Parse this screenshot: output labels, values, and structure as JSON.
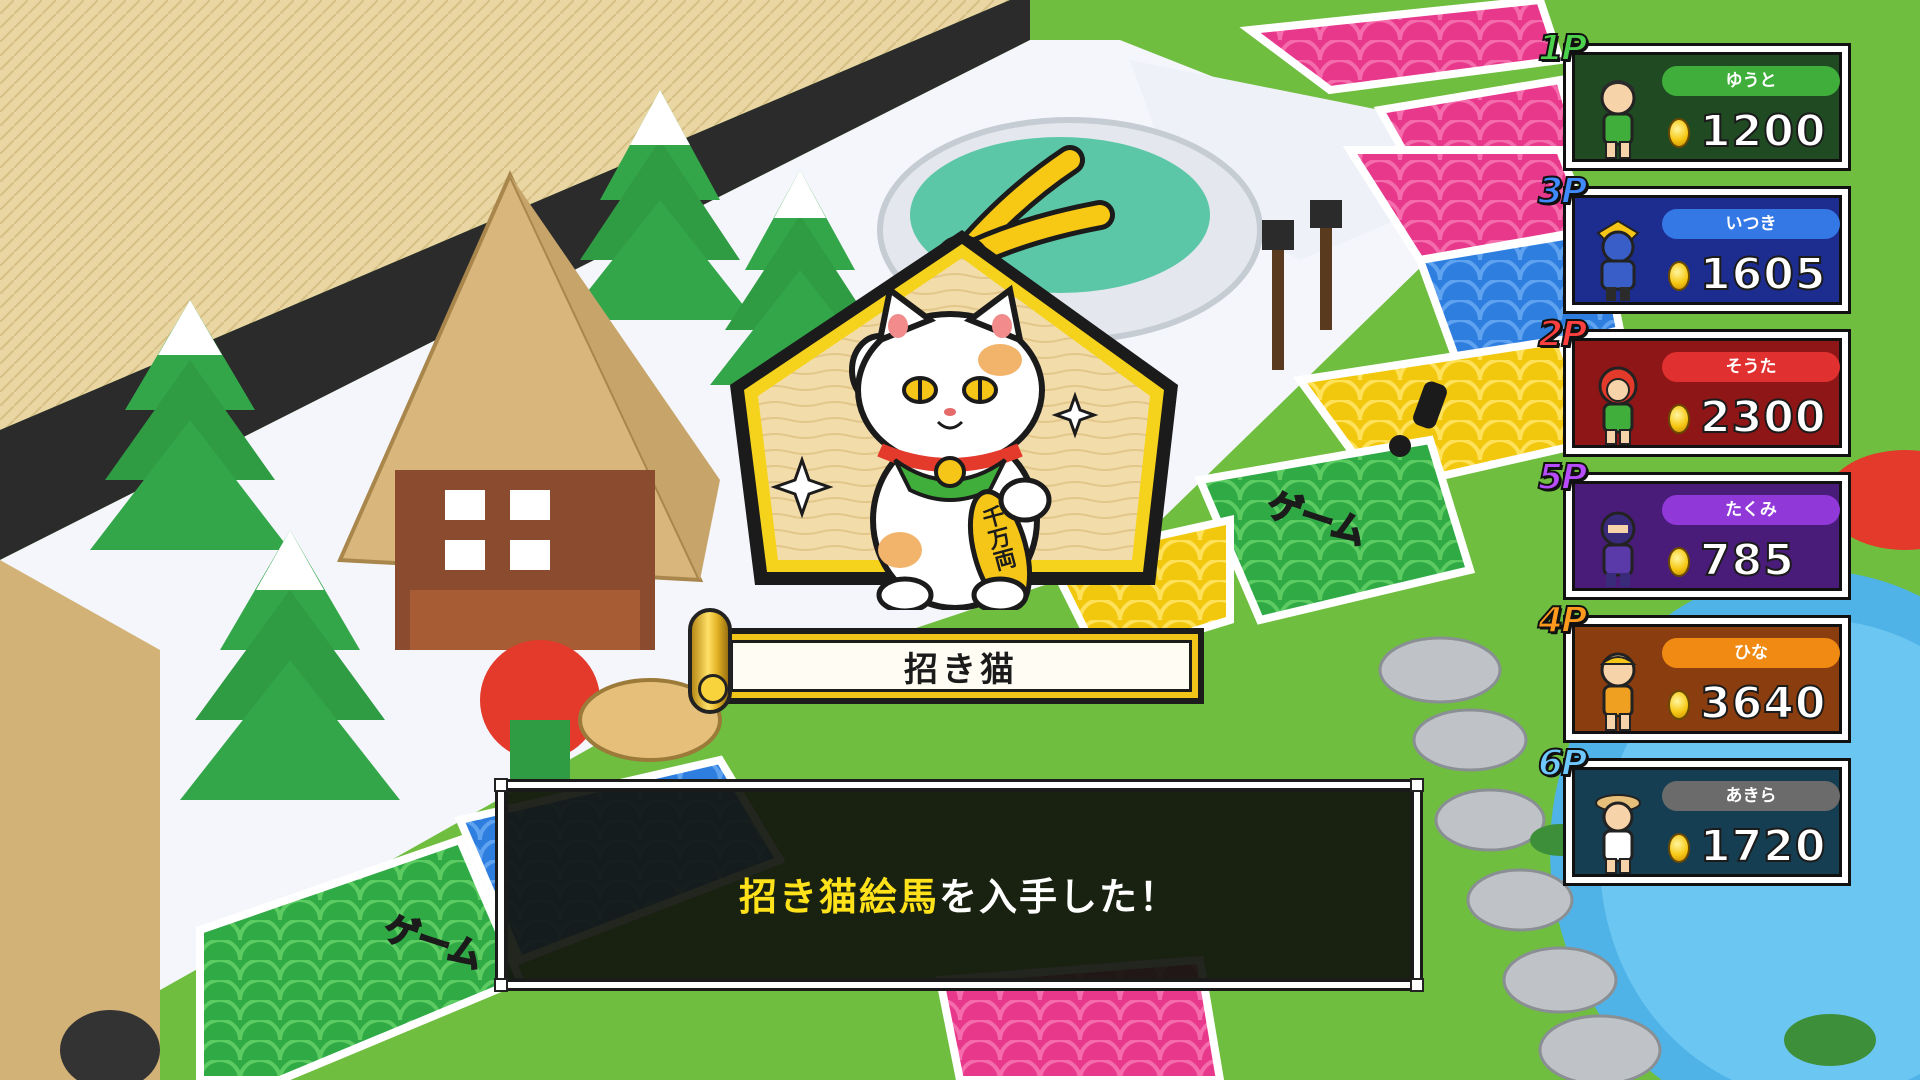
{
  "item": {
    "name": "招き猫",
    "plaque_text": "千万両"
  },
  "message": {
    "highlight": "招き猫絵馬",
    "rest": "を入手した！"
  },
  "board": {
    "tile_labels": [
      "ゲーム",
      "ゲーム"
    ]
  },
  "players": [
    {
      "tag": "1P",
      "name": "ゆうと",
      "score": "1200",
      "tag_color": "#4cd14c",
      "card_color": "#1f4a22",
      "pill_color": "#3fae3a"
    },
    {
      "tag": "3P",
      "name": "いつき",
      "score": "1605",
      "tag_color": "#3f8bff",
      "card_color": "#1d2d8f",
      "pill_color": "#3478e6"
    },
    {
      "tag": "2P",
      "name": "そうた",
      "score": "2300",
      "tag_color": "#ff4040",
      "card_color": "#8e1616",
      "pill_color": "#e03030"
    },
    {
      "tag": "5P",
      "name": "たくみ",
      "score": "785",
      "tag_color": "#b84dff",
      "card_color": "#4a1c7a",
      "pill_color": "#9038d8"
    },
    {
      "tag": "4P",
      "name": "ひな",
      "score": "3640",
      "tag_color": "#ff9a1f",
      "card_color": "#8a3d0e",
      "pill_color": "#f08a12"
    },
    {
      "tag": "6P",
      "name": "あきら",
      "score": "1720",
      "tag_color": "#6fc9ff",
      "card_color": "#153e52",
      "pill_color": "#6b6b6b"
    }
  ]
}
